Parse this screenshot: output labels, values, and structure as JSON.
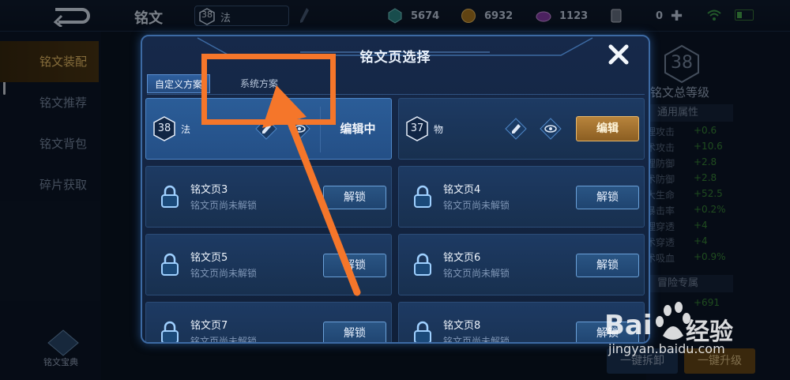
{
  "topbar": {
    "title": "铭文",
    "level": "38",
    "level_type": "法",
    "resources": [
      {
        "icon": "crystal-icon",
        "value": "5674"
      },
      {
        "icon": "gold-coin-icon",
        "value": "6932"
      },
      {
        "icon": "gem-icon",
        "value": "1123"
      },
      {
        "icon": "voucher-icon",
        "value": "0"
      }
    ]
  },
  "sidebar": {
    "items": [
      {
        "label": "铭文装配"
      },
      {
        "label": "铭文推荐"
      },
      {
        "label": "铭文背包"
      },
      {
        "label": "碎片获取"
      }
    ],
    "codex_label": "铭文宝典"
  },
  "right_panel": {
    "total_level": "38",
    "total_label": "铭文总等级",
    "general_heading": "通用属性",
    "stats": [
      {
        "k": "理攻击",
        "v": "+0.6"
      },
      {
        "k": "术攻击",
        "v": "+10.6"
      },
      {
        "k": "理防御",
        "v": "+2.8"
      },
      {
        "k": "术防御",
        "v": "+2.8"
      },
      {
        "k": "大生命",
        "v": "+52.5"
      },
      {
        "k": "暴击率",
        "v": "+0.2%"
      },
      {
        "k": "理穿透",
        "v": "+4"
      },
      {
        "k": "术穿透",
        "v": "+4"
      },
      {
        "k": "术吸血",
        "v": "+0.9%"
      }
    ],
    "adventure_heading": "冒险专属",
    "adventure_value": "+691",
    "btn_remove": "一键拆卸",
    "btn_upgrade": "一键升级"
  },
  "dialog": {
    "title": "铭文页选择",
    "tabs": [
      "自定义方案",
      "系统方案"
    ],
    "pages": [
      {
        "level": "38",
        "type": "法",
        "state": "编辑中"
      },
      {
        "level": "37",
        "type": "物",
        "action": "编辑"
      }
    ],
    "locked": [
      {
        "name": "铭文页3",
        "status": "铭文页尚未解锁",
        "action": "解锁"
      },
      {
        "name": "铭文页4",
        "status": "铭文页尚未解锁",
        "action": "解锁"
      },
      {
        "name": "铭文页5",
        "status": "铭文页尚未解锁",
        "action": "解锁"
      },
      {
        "name": "铭文页6",
        "status": "铭文页尚未解锁",
        "action": "解锁"
      },
      {
        "name": "铭文页7",
        "status": "铭文页尚未解锁",
        "action": "解锁"
      },
      {
        "name": "铭文页8",
        "status": "铭文页尚未解锁",
        "action": "解锁"
      }
    ]
  },
  "watermark": {
    "text": "经验",
    "url": "jingyan.baidu.com"
  },
  "colors": {
    "annotation": "#f5762a",
    "accent": "#3d6aa3",
    "gold": "#b8843c"
  }
}
